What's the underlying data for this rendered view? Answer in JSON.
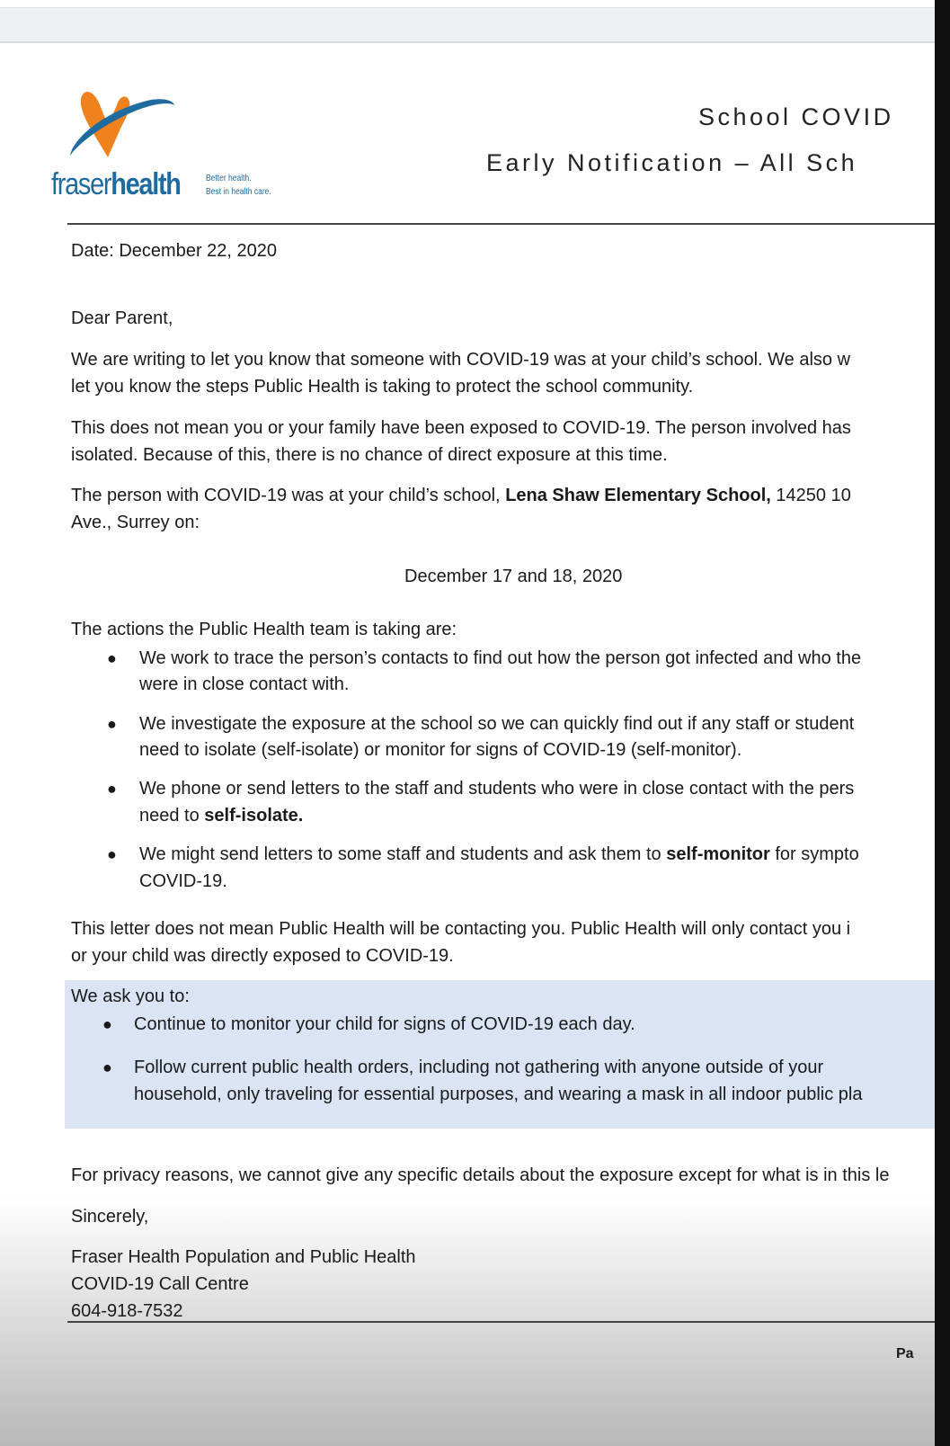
{
  "header": {
    "logo": {
      "name_light": "fraser",
      "name_bold": "health",
      "tagline_1": "Better health.",
      "tagline_2": "Best in health care.",
      "colors": {
        "orange": "#f0821e",
        "blue": "#1f6a9e"
      }
    },
    "title_1": "School COVID",
    "title_2": "Early Notification – All Sch"
  },
  "letter": {
    "date": "Date: December 22, 2020",
    "greeting": "Dear Parent,",
    "p1": [
      "We are writing to let you know that someone with COVID-19 was at your child’s school. We also w",
      "let you know the steps Public Health is taking to protect the school community."
    ],
    "p2": [
      "This does not mean you or your family have been exposed to COVID-19. The person involved has",
      "isolated. Because of this, there is no chance of direct exposure at this time."
    ],
    "p3": {
      "a": "The person with COVID-19 was at your child’s school, ",
      "school": "Lena Shaw Elementary School,",
      "b": " 14250 10",
      "line2": "Ave., Surrey on:"
    },
    "dates": "December 17 and 18, 2020",
    "actions_intro": "The actions the Public Health team is taking are:",
    "actions": [
      {
        "l1": "We work to trace the person’s contacts to find out how the person got infected and who the",
        "l2": "were in close contact with."
      },
      {
        "l1": "We investigate the exposure at the school so we can quickly find out if any staff or student",
        "l2": "need to isolate (self-isolate) or monitor for signs of COVID-19 (self-monitor)."
      },
      {
        "l1": "We phone or send letters to the staff and students who were in close contact with the pers",
        "l2a": "need to ",
        "l2b": "self-isolate."
      },
      {
        "l1a": "We might send letters to some staff and students and ask them to ",
        "l1b": "self-monitor",
        "l1c": " for sympto",
        "l2": "COVID-19."
      }
    ],
    "p4": [
      "This letter does not mean Public Health will be contacting you. Public Health will only contact you i",
      "or your child was directly exposed to COVID-19."
    ],
    "ask": {
      "intro": "We ask you to:",
      "items": [
        {
          "l1": "Continue to monitor your child for signs of COVID-19 each day."
        },
        {
          "l1": "Follow current public health orders, including not gathering with anyone outside of your",
          "l2": "household, only traveling for essential purposes, and wearing a mask in all indoor public pla"
        }
      ],
      "bg_color": "#dbe4f4"
    },
    "privacy": "For privacy reasons, we cannot give any specific details about the exposure except for what is in this le",
    "closing": "Sincerely,",
    "signature": [
      "Fraser Health Population and Public Health",
      "COVID-19 Call Centre",
      "604-918-7532"
    ],
    "footer_page": "Pa"
  }
}
